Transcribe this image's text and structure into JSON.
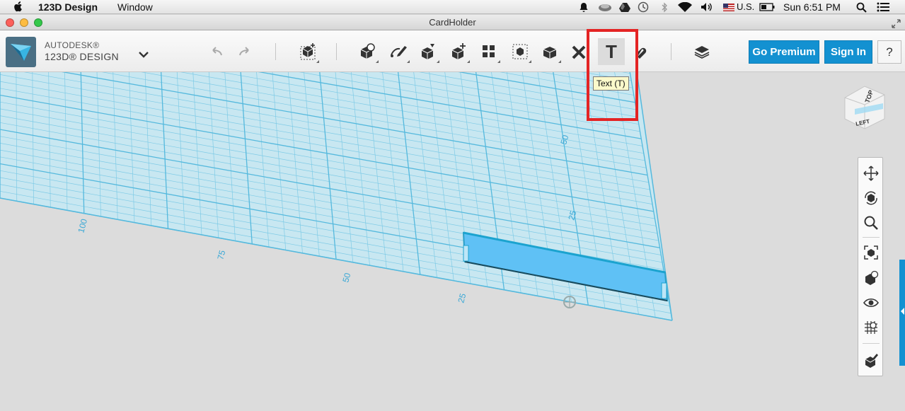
{
  "menubar": {
    "apple_icon": "apple-icon",
    "app_name": "123D Design",
    "menu_window": "Window",
    "status_icons": [
      "notification-icon",
      "cloud-sync-icon",
      "drive-icon",
      "time-machine-icon",
      "bluetooth-icon",
      "wifi-icon",
      "volume-icon",
      "flag-icon",
      "battery-icon"
    ],
    "input_source": "U.S.",
    "clock": "Sun 6:51 PM"
  },
  "window": {
    "title": "CardHolder"
  },
  "app": {
    "brand_line1": "AUTODESK®",
    "brand_line2": "123D® DESIGN"
  },
  "toolbar": {
    "undo_icon": "undo-icon",
    "redo_icon": "redo-icon",
    "tools": [
      "transform",
      "primitives",
      "sketch",
      "construct",
      "modify",
      "pattern",
      "group",
      "combine",
      "measure",
      "text",
      "snap",
      "material"
    ],
    "text_tool_label": "T",
    "tooltip": "Text (T)",
    "go_premium": "Go Premium",
    "sign_in": "Sign In",
    "help": "?"
  },
  "viewcube": {
    "top": "TOP",
    "left": "LEFT"
  },
  "grid_labels": {
    "x": [
      "100",
      "75",
      "50",
      "25"
    ],
    "y": [
      "50",
      "25"
    ]
  },
  "nav": [
    "pan",
    "orbit",
    "zoom",
    "fit",
    "view-mode",
    "visibility",
    "grid",
    "material"
  ],
  "colors": {
    "accent": "#1391d1",
    "grid": "#6ec6e6",
    "part": "#5fc1f5",
    "highlight": "#e42424"
  }
}
